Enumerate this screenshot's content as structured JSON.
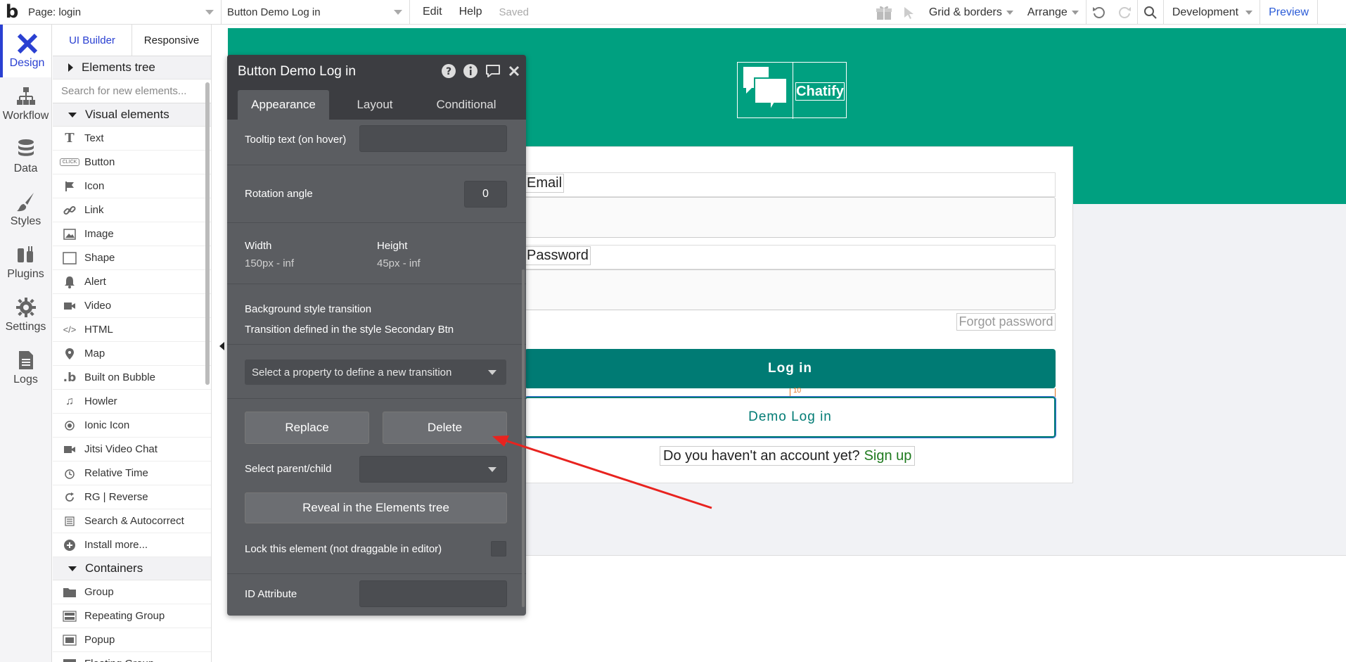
{
  "topbar": {
    "logo": "b",
    "page_select": "Page: login",
    "element_select": "Button Demo Log in",
    "menu_edit": "Edit",
    "menu_help": "Help",
    "status": "Saved",
    "grid": "Grid & borders",
    "arrange": "Arrange",
    "env": "Development",
    "preview": "Preview"
  },
  "rail": {
    "design": "Design",
    "workflow": "Workflow",
    "data": "Data",
    "styles": "Styles",
    "plugins": "Plugins",
    "settings": "Settings",
    "logs": "Logs"
  },
  "palette": {
    "tab_ui": "UI Builder",
    "tab_responsive": "Responsive",
    "elements_tree": "Elements tree",
    "search_placeholder": "Search for new elements...",
    "visual_section": "Visual elements",
    "items": [
      {
        "label": "Text",
        "icon": "T"
      },
      {
        "label": "Button",
        "icon": "CLICK"
      },
      {
        "label": "Icon",
        "icon": "flag"
      },
      {
        "label": "Link",
        "icon": "link"
      },
      {
        "label": "Image",
        "icon": "image"
      },
      {
        "label": "Shape",
        "icon": "shape"
      },
      {
        "label": "Alert",
        "icon": "bell"
      },
      {
        "label": "Video",
        "icon": "video"
      },
      {
        "label": "HTML",
        "icon": "</>"
      },
      {
        "label": "Map",
        "icon": "pin"
      },
      {
        "label": "Built on Bubble",
        "icon": "b"
      },
      {
        "label": "Howler",
        "icon": "note"
      },
      {
        "label": "Ionic Icon",
        "icon": "ring"
      },
      {
        "label": "Jitsi Video Chat",
        "icon": "video"
      },
      {
        "label": "Relative Time",
        "icon": "clock"
      },
      {
        "label": "RG | Reverse",
        "icon": "reload"
      },
      {
        "label": "Search & Autocorrect",
        "icon": "list"
      },
      {
        "label": "Install more...",
        "icon": "plus"
      }
    ],
    "containers_section": "Containers",
    "containers": [
      {
        "label": "Group",
        "icon": "folder"
      },
      {
        "label": "Repeating Group",
        "icon": "stack"
      },
      {
        "label": "Popup",
        "icon": "popup"
      },
      {
        "label": "Floating Group",
        "icon": "float"
      }
    ]
  },
  "canvas": {
    "logo_text": "Chatify",
    "email_label": "Email",
    "password_label": "Password",
    "forgot": "Forgot password",
    "login_button": "Log in",
    "gap_value": "10",
    "demo_button": "Demo Log in",
    "signup_text": "Do you haven't an account yet?",
    "signup_link": "Sign up"
  },
  "editor": {
    "title": "Button Demo Log in",
    "tab_appearance": "Appearance",
    "tab_layout": "Layout",
    "tab_conditional": "Conditional",
    "tooltip_label": "Tooltip text (on hover)",
    "rotation_label": "Rotation angle",
    "rotation_value": "0",
    "width_label": "Width",
    "width_value": "150px - inf",
    "height_label": "Height",
    "height_value": "45px - inf",
    "transition_label": "Background style transition",
    "transition_desc": "Transition defined in the style Secondary Btn",
    "transition_select": "Select a property to define a new transition",
    "replace": "Replace",
    "delete": "Delete",
    "parent_label": "Select parent/child",
    "reveal": "Reveal in the Elements tree",
    "lock_label": "Lock this element (not draggable in editor)",
    "id_label": "ID Attribute"
  },
  "colors": {
    "header_green": "#00a080",
    "primary_teal": "#007b74",
    "editor_bg": "#5b5d61",
    "editor_head": "#3c3d41",
    "accent_blue": "#2a40d2",
    "arrow_red": "#e8231f"
  }
}
